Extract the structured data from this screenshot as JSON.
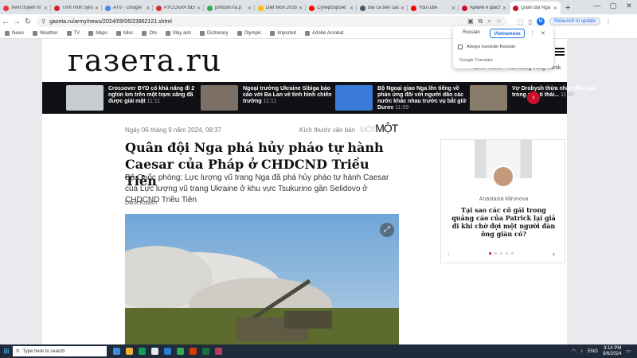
{
  "tabs": [
    {
      "title": "Xem truyền hì",
      "color": "#e53935",
      "active": false
    },
    {
      "title": "Tình hình Syria",
      "color": "#c62828",
      "active": false
    },
    {
      "title": "ATV - Google",
      "color": "#4285f4",
      "active": false
    },
    {
      "title": "РУССКАЯ ВЕСН",
      "color": "#d32f2f",
      "active": false
    },
    {
      "title": "pm658i7Ia.p",
      "color": "#34a853",
      "active": false
    },
    {
      "title": "Diệt Môn 2016",
      "color": "#fbbc05",
      "active": false
    },
    {
      "title": "Суперборонс",
      "color": "#ff0000",
      "active": false
    },
    {
      "title": "Bài ca bên cầu",
      "color": "#455a64",
      "active": false
    },
    {
      "title": "YouTube",
      "color": "#ff0000",
      "active": false
    },
    {
      "title": "Армия и фаст",
      "color": "#c8102e",
      "active": false
    },
    {
      "title": "Quân đội Nga",
      "color": "#c8102e",
      "active": true
    }
  ],
  "toolbar": {
    "url": "gazeta.ru/army/news/2024/09/06/23862121.shtml",
    "relaunch_label": "Relaunch to update",
    "avatar_letter": "M"
  },
  "bookmarks": [
    "News",
    "Weather",
    "TV",
    "Maps",
    "Misc",
    "Oto",
    "May anh",
    "Dictionary",
    "Olympic",
    "Imported",
    "Adobe Acrobat"
  ],
  "site": {
    "logo": "газета.ru",
    "header_meta": "11:07  Kursk  · Hàn bông vùng Kursk",
    "strip": [
      {
        "text": "Crossover BYD có khả năng đi 2 nghìn km trên một trạm xăng đã được giải mật",
        "time": "11:11",
        "thumb_color": "#c9ccd1"
      },
      {
        "text": "Ngoại trưởng Ukraine Sibiga bảo cáo với Ba Lan về tình hình chiến trường",
        "time": "11:11",
        "thumb_color": "#7b6f66"
      },
      {
        "text": "Bộ Ngoại giao Nga lên tiếng về phản ứng đối với người dân các nước khác nhau trước vụ bắt giữ Durov",
        "time": "11:09",
        "thumb_color": "#3b7bd8"
      },
      {
        "text": "Vợ Drobysh thừa nhận đâu của trong một ti thái...",
        "time": "11:07",
        "thumb_color": "#8a7c6a"
      }
    ]
  },
  "article": {
    "date": "Ngày 06 tháng 9 năm 2024, 08:37",
    "size_label": "Kích thước văn bản",
    "size_small": "MỘT",
    "size_large": "MỘT",
    "title": "Quân đội Nga phá hủy pháo tự hành Caesar của Pháp ở CHDCND Triều Tiên",
    "lead": "Bộ Quốc phòng: Lực lượng vũ trang Nga đã phá hủy pháo tự hành Caesar của Lực lượng vũ trang Ukraine ở khu vực Tsukurino gần Selidovo ở CHDCND Triều Tiên",
    "author": "Daria Kolash"
  },
  "sidebar_card": {
    "author": "Anastasia Mironova",
    "title": "Tại sao các cô gái trong quảng cáo của Patrick lại giả đi khi chờ đợi một người đàn ông giàu có?"
  },
  "translate_popup": {
    "source": "Russian",
    "target": "Vietnamese",
    "always_label": "Always translate Russian",
    "brand": "Google Translate"
  },
  "taskbar": {
    "search_placeholder": "Type here to search",
    "lang": "ENG",
    "time": "3:14 PM",
    "date": "9/6/2024",
    "apps": [
      "#3c8ce7",
      "#f2b233",
      "#0f9d58",
      "#e8eaed",
      "#2b7cd3",
      "#2db04f",
      "#d83b01",
      "#1d6f42",
      "#b83b5e"
    ]
  }
}
